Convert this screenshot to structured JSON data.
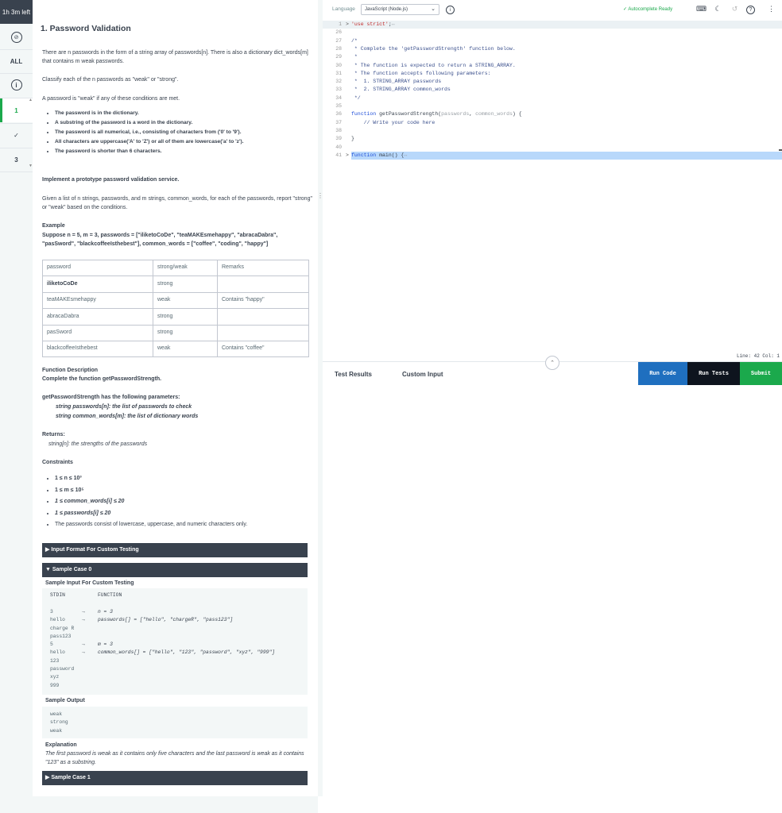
{
  "sidebar": {
    "timer": "1h 3m left",
    "all_label": "ALL",
    "q1": "1",
    "q3": "3"
  },
  "problem": {
    "title": "1. Password Validation",
    "intro1": "There are n passwords in the form of a string array of passwords[n]. There is also a dictionary dict_words[m] that contains m weak passwords.",
    "intro2": "Classify each of the n passwords as \"weak\" or \"strong\".",
    "intro3": "A password is \"weak\" if any of these conditions are met.",
    "conditions": [
      "The password is in the dictionary.",
      "A substring of the password is a word in the dictionary.",
      "The password is all numerical, i.e., consisting of characters from ('0' to '9').",
      "All characters are uppercase('A' to 'Z') or all of them are lowercase('a' to 'z').",
      "The password is shorter than 6 characters."
    ],
    "implement": "Implement a prototype password validation service.",
    "given": "Given a list of n strings, passwords, and m strings, common_words, for each of the passwords, report \"strong\" or \"weak\" based on the conditions.",
    "example_heading": "Example",
    "example_line1": "Suppose n = 5, m = 3, passwords = [\"iliketoCoDe\", \"teaMAKEsmehappy\", \"abracaDabra\",",
    "example_line2": "\"pasSword\", \"blackcoffeeIsthebest\"], common_words = [\"coffee\", \"coding\", \"happy\"]",
    "table_headers": [
      "password",
      "strong/weak",
      "Remarks"
    ],
    "table_rows": [
      [
        "iliketoCoDe",
        "strong",
        ""
      ],
      [
        "teaMAKEsmehappy",
        "weak",
        "Contains \"happy\""
      ],
      [
        "abracaDabra",
        "strong",
        ""
      ],
      [
        "pasSword",
        "strong",
        ""
      ],
      [
        "blackcoffeeIsthebest",
        "weak",
        "Contains \"coffee\""
      ]
    ],
    "func_desc_heading": "Function Description",
    "func_desc": "Complete the function getPasswordStrength.",
    "params_heading": "getPasswordStrength has the following parameters:",
    "param1": "string passwords[n]: the list of passwords to check",
    "param2": "string common_words[m]: the list of dictionary words",
    "returns_heading": "Returns:",
    "returns": "string[n]: the strengths of the passwords",
    "constraints_heading": "Constraints",
    "constraints": [
      "1 ≤ n ≤ 10³",
      "1 ≤ m ≤ 10⁵",
      "1 ≤ common_words[i] ≤ 20",
      "1 ≤ passwords[i] ≤ 20",
      "The passwords consist of lowercase, uppercase, and numeric characters only."
    ],
    "input_format_bar": "▶ Input Format For Custom Testing",
    "sample0_bar": "▼ Sample Case 0",
    "sample_input_heading": "Sample Input For Custom Testing",
    "stdin_label": "STDIN",
    "function_label": "FUNCTION",
    "stdin_lines": "3\nhello\ncharge R\npass123\n5\nhello\n123\npassword\nxyz\n999",
    "arrow_lines": "→\n→\n\n\n→\n→",
    "function_lines": "n = 3\npasswords[] = [\"hello\", \"chargeR\", \"pass123\"]\n\n\nm = 3\ncommon_words[] = [\"hello\", \"123\", \"password\", \"xyz\", \"999\"]",
    "sample_output_heading": "Sample Output",
    "sample_output": "weak\nstrong\nweak",
    "explanation_heading": "Explanation",
    "explanation": "The first password is weak as it contains only five characters and the last password is weak as it contains \"123\" as a substring.",
    "sample1_bar": "▶ Sample Case 1"
  },
  "editor": {
    "language_label": "Language",
    "language_value": "JavaScript (Node.js)",
    "autocomplete": "Autocomplete Ready",
    "lines": [
      {
        "n": "1",
        "fold": ">",
        "html": "<span class='str'>'use strict'</span>;<span class='param'>↔</span>"
      },
      {
        "n": "26",
        "fold": "",
        "html": ""
      },
      {
        "n": "27",
        "fold": "",
        "html": "<span class='cm'>/*</span>"
      },
      {
        "n": "28",
        "fold": "",
        "html": "<span class='cm'> * Complete the 'getPasswordStrength' function below.</span>"
      },
      {
        "n": "29",
        "fold": "",
        "html": "<span class='cm'> *</span>"
      },
      {
        "n": "30",
        "fold": "",
        "html": "<span class='cm'> * The function is expected to return a STRING_ARRAY.</span>"
      },
      {
        "n": "31",
        "fold": "",
        "html": "<span class='cm'> * The function accepts following parameters:</span>"
      },
      {
        "n": "32",
        "fold": "",
        "html": "<span class='cm'> *  1. STRING_ARRAY passwords</span>"
      },
      {
        "n": "33",
        "fold": "",
        "html": "<span class='cm'> *  2. STRING_ARRAY common_words</span>"
      },
      {
        "n": "34",
        "fold": "",
        "html": "<span class='cm'> */</span>"
      },
      {
        "n": "35",
        "fold": "",
        "html": ""
      },
      {
        "n": "36",
        "fold": "",
        "html": "<span class='kw'>function</span> getPasswordStrength(<span class='param'>passwords</span>, <span class='param'>common_words</span>) {"
      },
      {
        "n": "37",
        "fold": "",
        "html": "    <span class='cm'>// Write your code here</span>"
      },
      {
        "n": "38",
        "fold": "",
        "html": ""
      },
      {
        "n": "39",
        "fold": "",
        "html": "}"
      },
      {
        "n": "40",
        "fold": "",
        "html": ""
      },
      {
        "n": "41",
        "fold": ">",
        "html": "<span class='kw'>function</span> main() {<span class='param'>↔</span>"
      }
    ],
    "status": "Line: 42 Col: 1",
    "tab_results": "Test Results",
    "tab_custom": "Custom Input",
    "run_code": "Run Code",
    "run_tests": "Run Tests",
    "submit": "Submit"
  },
  "colors": {
    "dark": "#39424e",
    "green": "#1ba94c",
    "run_code_bg": "#1f6fbf",
    "run_tests_bg": "#0e141e",
    "submit_bg": "#1ba94c"
  }
}
